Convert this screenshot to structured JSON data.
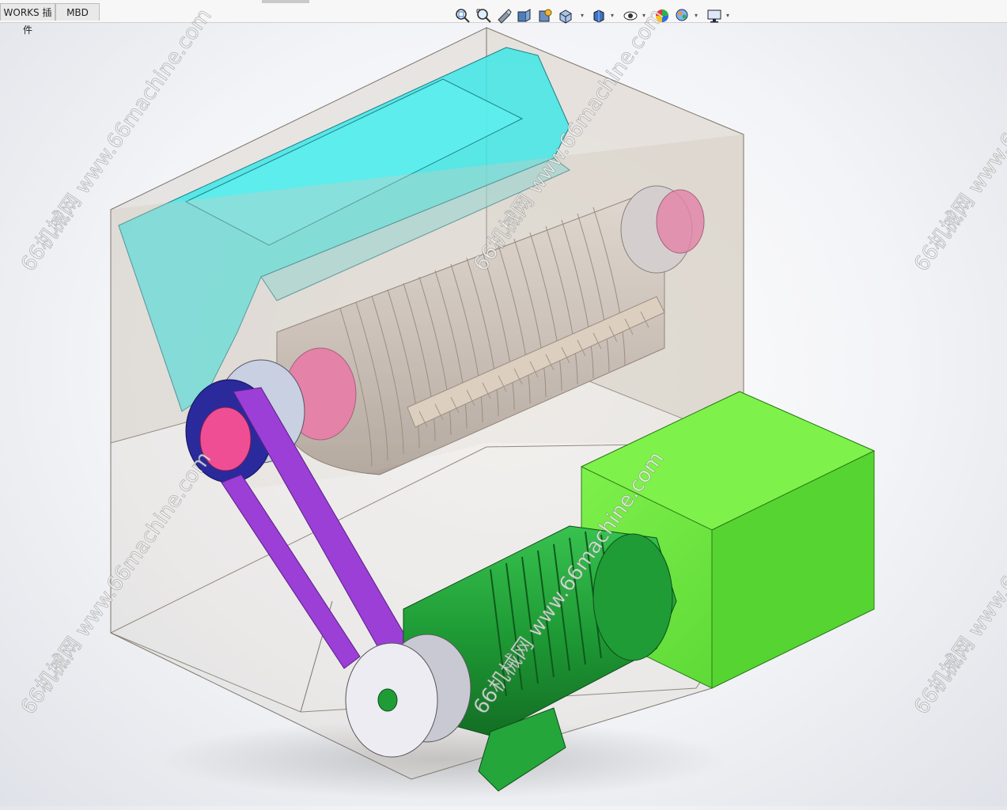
{
  "tabs": [
    {
      "label": "WORKS 插件"
    },
    {
      "label": "MBD"
    }
  ],
  "toolbar": {
    "icons": [
      "zoom-to-fit-icon",
      "zoom-to-area-icon",
      "previous-view-icon",
      "section-view-icon",
      "dynamic-annotation-icon",
      "view-orientation-icon",
      "display-style-icon",
      "hide-show-items-icon",
      "edit-appearance-icon",
      "apply-scene-icon",
      "view-settings-icon"
    ]
  },
  "model": {
    "name": "belt-driven drum crusher assembly",
    "colors": {
      "hopper": "#3fe6e6",
      "housing": "#d8cfc4",
      "drum": "#c9bdb6",
      "hub": "#ef5a9a",
      "drive_pulley": "#2a2a9c",
      "belt": "#9b3fd6",
      "motor": "#24a63a",
      "motor_pulley": "#e8e8ee",
      "guard_box": "#6ee83c"
    }
  },
  "watermark": {
    "text": "66机械网 www.66machine.com"
  }
}
